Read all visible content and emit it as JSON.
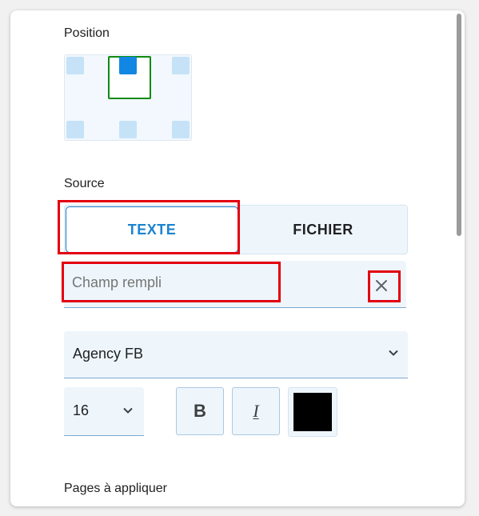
{
  "position": {
    "label": "Position",
    "selected": "top-center"
  },
  "source": {
    "label": "Source",
    "tabs": [
      {
        "label": "TEXTE",
        "active": true
      },
      {
        "label": "FICHIER",
        "active": false
      }
    ]
  },
  "text_field": {
    "placeholder": "Champ rempli",
    "value": ""
  },
  "font_select": {
    "value": "Agency FB"
  },
  "size_select": {
    "value": "16"
  },
  "format": {
    "bold_label": "B",
    "italic_label": "I",
    "color": "#000000"
  },
  "pages": {
    "label": "Pages à appliquer"
  },
  "colors": {
    "accent": "#1c83d0",
    "highlight": "#e3000f",
    "selected_cell": "#1187e3",
    "position_frame": "#0f8a0f"
  }
}
